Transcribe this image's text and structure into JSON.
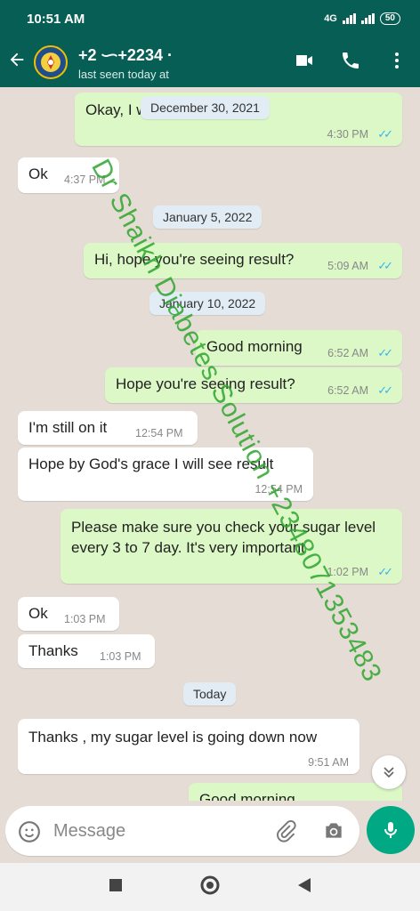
{
  "status_bar": {
    "time": "10:51 AM",
    "network": "4G",
    "battery": "50"
  },
  "header": {
    "contact_name": "+2 ᜑ+2234 ·",
    "subtitle": "last seen today at",
    "accent_color": "#075e54",
    "icons": [
      "back-arrow-icon",
      "video-call-icon",
      "phone-icon",
      "menu-icon"
    ]
  },
  "messages": [
    {
      "dir": "out",
      "text": "Okay, I will your testimony",
      "time": "4:30 PM",
      "ticks": "✓✓"
    },
    {
      "dir": "in",
      "text": "Ok",
      "time": "4:37 PM"
    },
    {
      "dir": "date",
      "text": "January 5, 2022"
    },
    {
      "dir": "out",
      "text": "Hi, hope you're seeing result?",
      "time": "5:09 AM",
      "ticks": "✓✓"
    },
    {
      "dir": "date",
      "text": "January 10, 2022"
    },
    {
      "dir": "out",
      "text": "Good morning",
      "time": "6:52 AM",
      "ticks": "✓✓"
    },
    {
      "dir": "out",
      "text": "Hope you're seeing result?",
      "time": "6:52 AM",
      "ticks": "✓✓"
    },
    {
      "dir": "in",
      "text": "I'm still on it",
      "time": "12:54 PM"
    },
    {
      "dir": "in",
      "text": "Hope by God's grace I will see result",
      "time": "12:54 PM"
    },
    {
      "dir": "out",
      "text": "Please make sure you check your sugar level every 3 to 7 day. It's very important",
      "time": "1:02 PM",
      "ticks": "✓✓"
    },
    {
      "dir": "in",
      "text": "Ok",
      "time": "1:03 PM"
    },
    {
      "dir": "in",
      "text": "Thanks",
      "time": "1:03 PM"
    },
    {
      "dir": "date",
      "text": "Today"
    },
    {
      "dir": "in",
      "text": "Thanks , my sugar level is going down now",
      "time": "9:51 AM"
    },
    {
      "dir": "out",
      "text": "Good morning",
      "time": ""
    }
  ],
  "floating_date": "December 30, 2021",
  "watermark": "Dr Shaikh Diabetes Solution +2348071353483",
  "input": {
    "placeholder": "Message"
  }
}
